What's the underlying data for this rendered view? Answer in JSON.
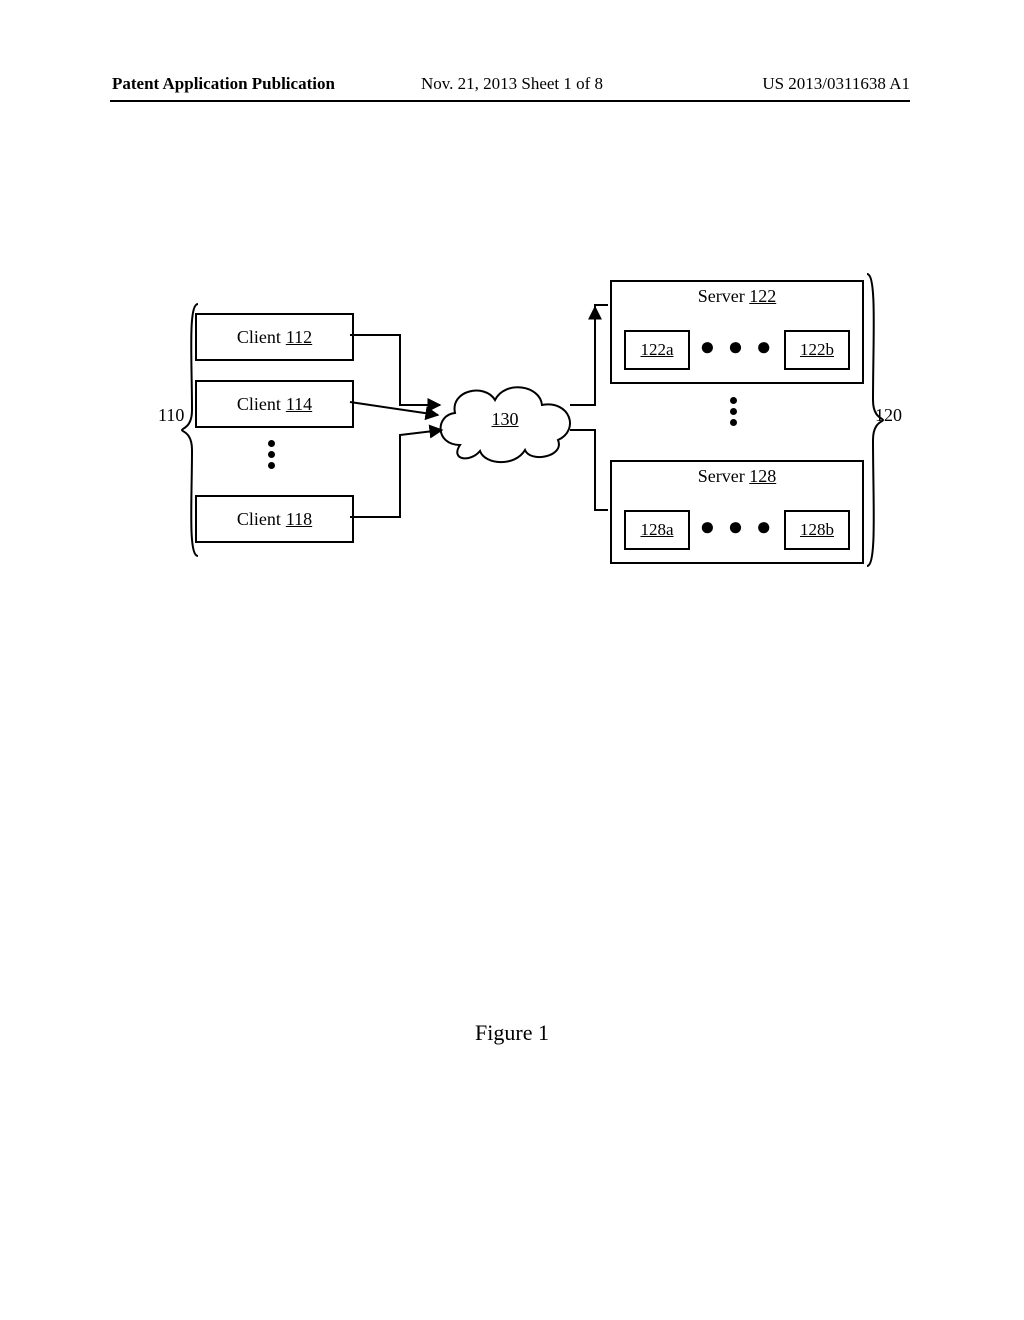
{
  "header": {
    "left": "Patent Application Publication",
    "center": "Nov. 21, 2013  Sheet 1 of 8",
    "right": "US 2013/0311638 A1"
  },
  "diagram": {
    "groups": {
      "clients": "110",
      "servers": "120"
    },
    "clients": {
      "label": "Client",
      "items": [
        {
          "ref": "112"
        },
        {
          "ref": "114"
        },
        {
          "ref": "118"
        }
      ]
    },
    "cloud": {
      "ref": "130"
    },
    "servers": {
      "label": "Server",
      "items": [
        {
          "ref": "122",
          "sub_left": "122a",
          "sub_right": "122b"
        },
        {
          "ref": "128",
          "sub_left": "128a",
          "sub_right": "128b"
        }
      ]
    }
  },
  "figure_caption": "Figure 1"
}
